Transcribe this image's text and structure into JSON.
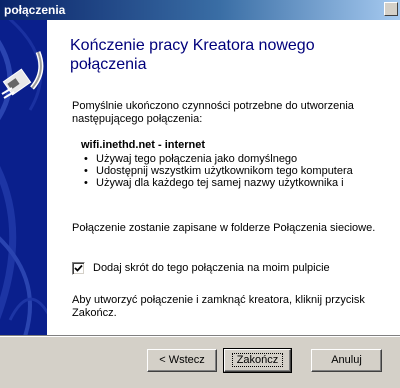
{
  "window": {
    "title": "połączenia"
  },
  "heading": "Kończenie pracy Kreatora nowego połączenia",
  "intro": "Pomyślnie ukończono czynności potrzebne do utworzenia następującego połączenia:",
  "connection_name": "wifi.inethd.net - internet",
  "options": [
    "Używaj tego połączenia jako domyślnego",
    "Udostępnij wszystkim użytkownikom tego komputera",
    "Używaj dla każdego tej samej nazwy użytkownika i"
  ],
  "save_info": "Połączenie zostanie zapisane w folderze Połączenia sieciowe.",
  "shortcut_checkbox": {
    "label": "Dodaj skrót do tego połączenia na moim pulpicie",
    "checked": true
  },
  "finish_info": "Aby utworzyć połączenie i zamknąć kreatora, kliknij przycisk Zakończ.",
  "buttons": {
    "back": "< Wstecz",
    "finish": "Zakończ",
    "cancel": "Anuluj"
  },
  "icons": {
    "sidebar": "network-cable-plug-icon",
    "checkmark": "checkmark-icon"
  },
  "colors": {
    "sidebar_bg": "#0a1f8c",
    "heading": "#00007b",
    "titlebar": "#0a246a"
  }
}
